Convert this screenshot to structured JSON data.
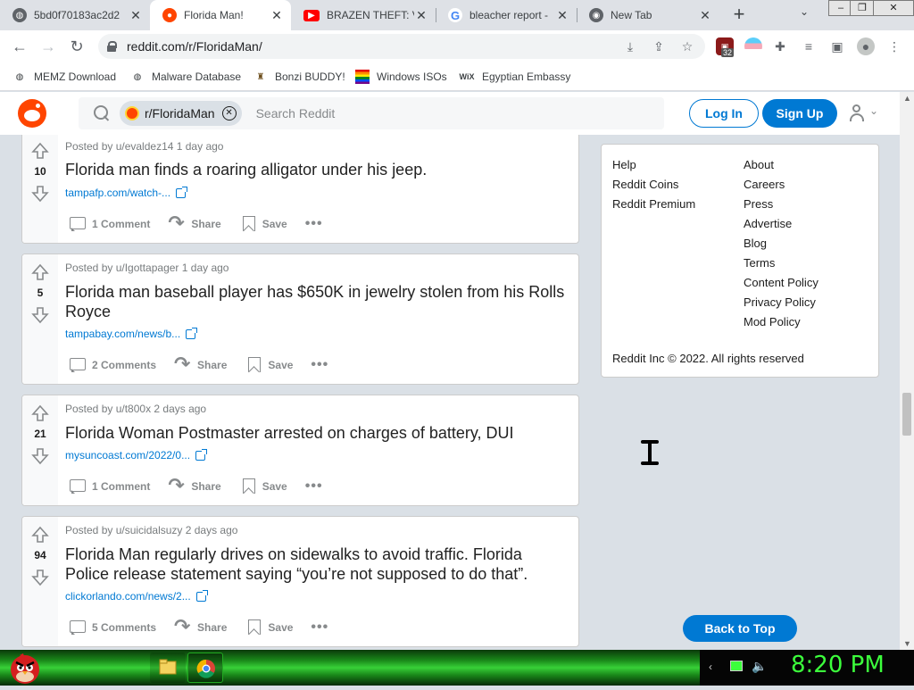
{
  "browser": {
    "tabs": [
      {
        "title": "5bd0f70183ac2d2",
        "icon": "globe-icon"
      },
      {
        "title": "Florida Man!",
        "icon": "reddit-icon"
      },
      {
        "title": "BRAZEN THEFT: V",
        "icon": "youtube-icon"
      },
      {
        "title": "bleacher report -",
        "icon": "google-icon"
      },
      {
        "title": "New Tab",
        "icon": "chrome-icon"
      }
    ],
    "url": "reddit.com/r/FloridaMan/",
    "extension_badge": "32",
    "bookmarks": [
      {
        "label": "MEMZ Download",
        "icon": "globe-icon"
      },
      {
        "label": "Malware Database",
        "icon": "globe-icon"
      },
      {
        "label": "Bonzi BUDDY!",
        "icon": "bonzi-icon"
      },
      {
        "label": "Windows ISOs",
        "icon": "windows-icon"
      },
      {
        "label": "Egyptian Embassy",
        "icon": "wix-icon"
      }
    ],
    "bookmark_wix_text": "WiX"
  },
  "reddit": {
    "community_chip": "r/FloridaMan",
    "search_placeholder": "Search Reddit",
    "login_label": "Log In",
    "signup_label": "Sign Up",
    "back_to_top": "Back to Top",
    "posts": [
      {
        "votes": "10",
        "meta": "Posted by u/evaldez14 1 day ago",
        "title": "Florida man finds a roaring alligator under his jeep.",
        "link": "tampafp.com/watch-...",
        "comments": "1 Comment",
        "share": "Share",
        "save": "Save"
      },
      {
        "votes": "5",
        "meta": "Posted by u/Igottapager 1 day ago",
        "title": "Florida man baseball player has $650K in jewelry stolen from his Rolls Royce",
        "link": "tampabay.com/news/b...",
        "comments": "2 Comments",
        "share": "Share",
        "save": "Save"
      },
      {
        "votes": "21",
        "meta": "Posted by u/t800x 2 days ago",
        "title": "Florida Woman Postmaster arrested on charges of battery, DUI",
        "link": "mysuncoast.com/2022/0...",
        "comments": "1 Comment",
        "share": "Share",
        "save": "Save"
      },
      {
        "votes": "94",
        "meta": "Posted by u/suicidalsuzy 2 days ago",
        "title": "Florida Man regularly drives on sidewalks to avoid traffic. Florida Police release statement saying “you’re not supposed to do that”.",
        "link": "clickorlando.com/news/2...",
        "comments": "5 Comments",
        "share": "Share",
        "save": "Save"
      }
    ],
    "sidebar": {
      "col1": [
        "Help",
        "Reddit Coins",
        "Reddit Premium"
      ],
      "col2": [
        "About",
        "Careers",
        "Press",
        "Advertise",
        "Blog",
        "Terms",
        "Content Policy",
        "Privacy Policy",
        "Mod Policy"
      ],
      "copyright": "Reddit Inc © 2022. All rights reserved"
    },
    "colors": {
      "accent": "#0079d3",
      "brand": "#ff4500"
    }
  },
  "taskbar": {
    "clock": "8:20 PM"
  }
}
